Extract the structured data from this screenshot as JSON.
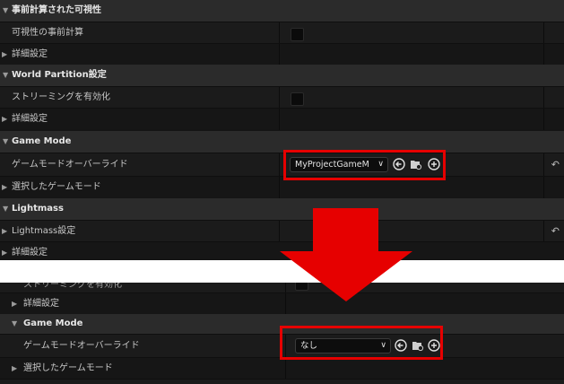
{
  "top": {
    "sections": {
      "precomputed_visibility": "事前計算された可視性",
      "precompute_visibility_label": "可視性の事前計算",
      "details": "詳細設定",
      "world_partition": "World Partition設定",
      "enable_streaming": "ストリーミングを有効化",
      "details2": "詳細設定",
      "game_mode": "Game Mode",
      "gamemode_override_label": "ゲームモードオーバーライド",
      "gamemode_override_value": "MyProjectGameM",
      "selected_gamemode": "選択したゲームモード",
      "lightmass": "Lightmass",
      "lightmass_settings": "Lightmass設定",
      "details3": "詳細設定"
    }
  },
  "bottom": {
    "partial_label": "ストリーミングを有効化",
    "details": "詳細設定",
    "game_mode": "Game Mode",
    "gamemode_override_label": "ゲームモードオーバーライド",
    "gamemode_override_value": "なし",
    "selected_gamemode": "選択したゲームモード"
  },
  "icons": {
    "back": "arrow-left-circle-icon",
    "browse": "folder-browse-icon",
    "add": "plus-circle-icon",
    "reset": "reset-arrow-icon",
    "dropdown": "chevron-down-icon",
    "arrow": "down-arrow-icon"
  },
  "colors": {
    "highlight": "#e60000",
    "background": "#151515",
    "header": "#2b2b2b"
  }
}
